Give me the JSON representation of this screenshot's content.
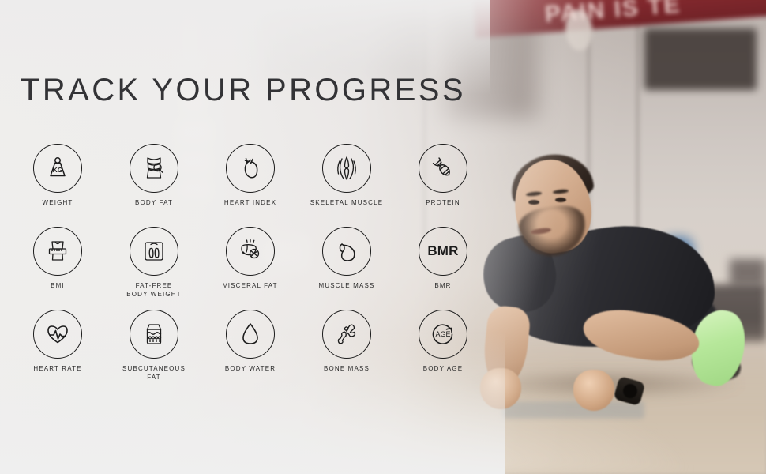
{
  "banner": {
    "title": "TRACK YOUR PROGRESS",
    "background_scene": "blurred gym interior with athlete doing a forearm plank",
    "wall_sign_text": "PAIN IS TE",
    "colors": {
      "title_text": "#333336",
      "label_text": "#2a2a2a",
      "icon_stroke": "#1c1c1c",
      "overlay_wash": "#f0efee",
      "wall_sign_red": "#7e2227",
      "shirt": "#232327",
      "shoe_accent": "#b6e79a"
    }
  },
  "metrics": {
    "rows": [
      [
        {
          "label": "WEIGHT",
          "icon": "weight-kg-icon"
        },
        {
          "label": "BODY FAT",
          "icon": "body-fat-icon"
        },
        {
          "label": "HEART INDEX",
          "icon": "heart-index-icon"
        },
        {
          "label": "SKELETAL MUSCLE",
          "icon": "skeletal-muscle-icon"
        },
        {
          "label": "PROTEIN",
          "icon": "protein-dna-icon"
        }
      ],
      [
        {
          "label": "BMI",
          "icon": "bmi-tape-icon"
        },
        {
          "label": "FAT-FREE\nBODY WEIGHT",
          "icon": "body-scale-icon"
        },
        {
          "label": "VISCERAL FAT",
          "icon": "visceral-fat-icon"
        },
        {
          "label": "MUSCLE MASS",
          "icon": "bicep-icon"
        },
        {
          "label": "BMR",
          "icon": "bmr-text-icon",
          "icon_text": "BMR"
        }
      ],
      [
        {
          "label": "HEART RATE",
          "icon": "heart-pulse-icon"
        },
        {
          "label": "SUBCUTANEOUS\nFAT",
          "icon": "subcutaneous-fat-icon"
        },
        {
          "label": "BODY WATER",
          "icon": "water-drop-icon"
        },
        {
          "label": "BONE MASS",
          "icon": "bone-mass-icon"
        },
        {
          "label": "BODY  AGE",
          "icon": "body-age-icon",
          "icon_text": "AGE"
        }
      ]
    ]
  }
}
